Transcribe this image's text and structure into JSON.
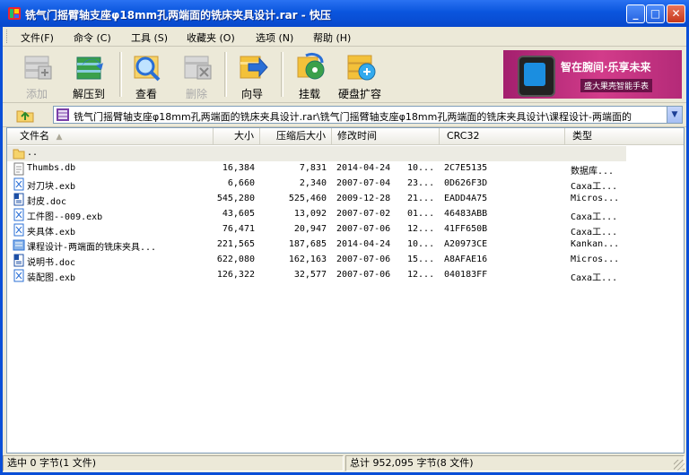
{
  "window": {
    "title": "铣气门摇臂轴支座φ18mm孔两端面的铣床夹具设计.rar - 快压",
    "minimize": "_",
    "maximize": "□",
    "close": "✕"
  },
  "menu": [
    {
      "label": "文件(F)"
    },
    {
      "label": "命令 (C)"
    },
    {
      "label": "工具 (S)"
    },
    {
      "label": "收藏夹 (O)"
    },
    {
      "label": "选项 (N)"
    },
    {
      "label": "帮助 (H)"
    }
  ],
  "toolbar": [
    {
      "label": "添加",
      "icon": "add-icon",
      "disabled": true
    },
    {
      "label": "解压到",
      "icon": "extract-icon",
      "disabled": false
    },
    {
      "label": "查看",
      "icon": "view-icon",
      "disabled": false
    },
    {
      "label": "删除",
      "icon": "delete-icon",
      "disabled": true
    },
    {
      "label": "向导",
      "icon": "wizard-icon",
      "disabled": false
    },
    {
      "label": "挂载",
      "icon": "mount-icon",
      "disabled": false
    },
    {
      "label": "硬盘扩容",
      "icon": "disk-expand-icon",
      "disabled": false
    }
  ],
  "ad": {
    "headline": "智在腕间·乐享未来",
    "sub": "盛大果壳智能手表"
  },
  "address": {
    "path": "铣气门摇臂轴支座φ18mm孔两端面的铣床夹具设计.rar\\铣气门摇臂轴支座φ18mm孔两端面的铣床夹具设计\\课程设计-两端面的"
  },
  "columns": [
    "文件名",
    "大小",
    "压缩后大小",
    "修改时间",
    "CRC32",
    "类型"
  ],
  "parent_row": {
    "name": ".."
  },
  "files": [
    {
      "name": "Thumbs.db",
      "icon": "db-file-icon",
      "size": "16,384",
      "packed": "7,831",
      "date": "2014-04-24",
      "time": "10...",
      "crc": "2C7E5135",
      "type": "数据库..."
    },
    {
      "name": "对刀块.exb",
      "icon": "exb-file-icon",
      "size": "6,660",
      "packed": "2,340",
      "date": "2007-07-04",
      "time": "23...",
      "crc": "0D626F3D",
      "type": "Caxa工..."
    },
    {
      "name": "封皮.doc",
      "icon": "doc-file-icon",
      "size": "545,280",
      "packed": "525,460",
      "date": "2009-12-28",
      "time": "21...",
      "crc": "EADD4A75",
      "type": "Micros..."
    },
    {
      "name": "工件图--009.exb",
      "icon": "exb-file-icon",
      "size": "43,605",
      "packed": "13,092",
      "date": "2007-07-02",
      "time": "01...",
      "crc": "46483ABB",
      "type": "Caxa工..."
    },
    {
      "name": "夹具体.exb",
      "icon": "exb-file-icon",
      "size": "76,471",
      "packed": "20,947",
      "date": "2007-07-06",
      "time": "12...",
      "crc": "41FF650B",
      "type": "Caxa工..."
    },
    {
      "name": "课程设计-两端面的铣床夹具...",
      "icon": "kankan-file-icon",
      "size": "221,565",
      "packed": "187,685",
      "date": "2014-04-24",
      "time": "10...",
      "crc": "A20973CE",
      "type": "Kankan..."
    },
    {
      "name": "说明书.doc",
      "icon": "doc-file-icon",
      "size": "622,080",
      "packed": "162,163",
      "date": "2007-07-06",
      "time": "15...",
      "crc": "A8AFAE16",
      "type": "Micros..."
    },
    {
      "name": "装配图.exb",
      "icon": "exb-file-icon",
      "size": "126,322",
      "packed": "32,577",
      "date": "2007-07-06",
      "time": "12...",
      "crc": "040183FF",
      "type": "Caxa工..."
    }
  ],
  "status": {
    "left": "选中   0 字节(1 文件)",
    "right": "总计   952,095 字节(8 文件)"
  },
  "colors": {
    "title_blue": "#0a55dd",
    "chrome": "#ece9d8",
    "ad_pink": "#d23c8a"
  }
}
